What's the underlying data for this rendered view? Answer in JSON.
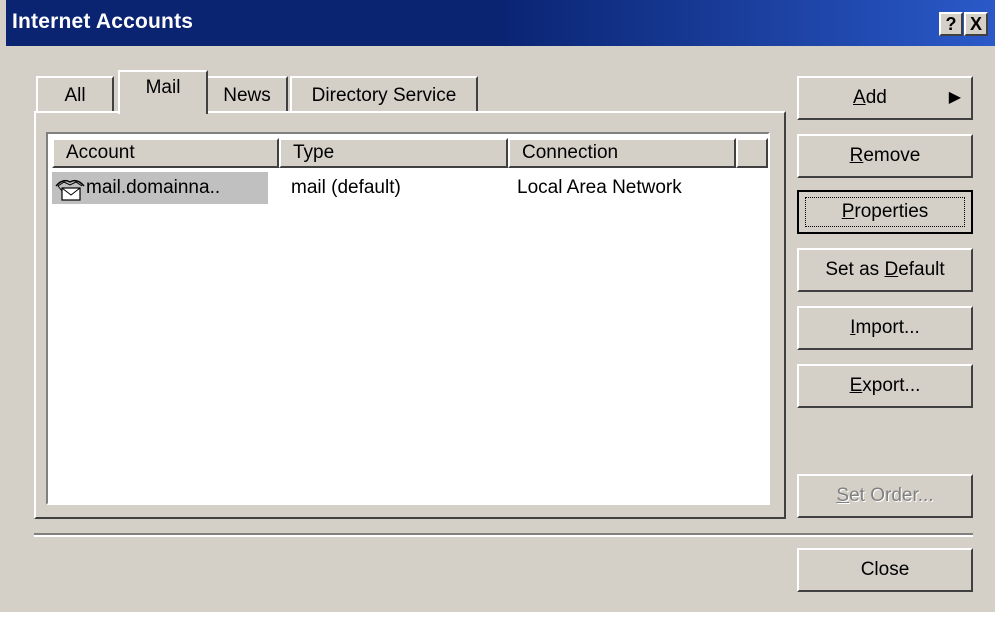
{
  "window": {
    "title": "Internet Accounts",
    "help_button": "?",
    "close_button": "X"
  },
  "tabs": [
    {
      "label": "All",
      "selected": false
    },
    {
      "label": "Mail",
      "selected": true
    },
    {
      "label": "News",
      "selected": false
    },
    {
      "label": "Directory Service",
      "selected": false
    }
  ],
  "list": {
    "columns": [
      "Account",
      "Type",
      "Connection"
    ],
    "rows": [
      {
        "account": "mail.domainna..",
        "type": "mail (default)",
        "connection": "Local Area Network",
        "icon": "mail-account-icon"
      }
    ]
  },
  "buttons": {
    "add": {
      "pre": "",
      "acc": "A",
      "post": "dd",
      "arrow": "▶"
    },
    "remove": {
      "pre": "",
      "acc": "R",
      "post": "emove"
    },
    "properties": {
      "pre": "",
      "acc": "P",
      "post": "roperties"
    },
    "set_default": {
      "pre": "Set as ",
      "acc": "D",
      "post": "efault"
    },
    "import": {
      "pre": "",
      "acc": "I",
      "post": "mport..."
    },
    "export": {
      "pre": "",
      "acc": "E",
      "post": "xport..."
    },
    "set_order": {
      "pre": "",
      "acc": "S",
      "post": "et Order...",
      "disabled": true
    },
    "close": {
      "label": "Close"
    }
  },
  "colors": {
    "titlebar_start": "#0a2472",
    "titlebar_end": "#2a59c8",
    "face": "#d4d0c8",
    "selection": "#c0c0c0"
  }
}
